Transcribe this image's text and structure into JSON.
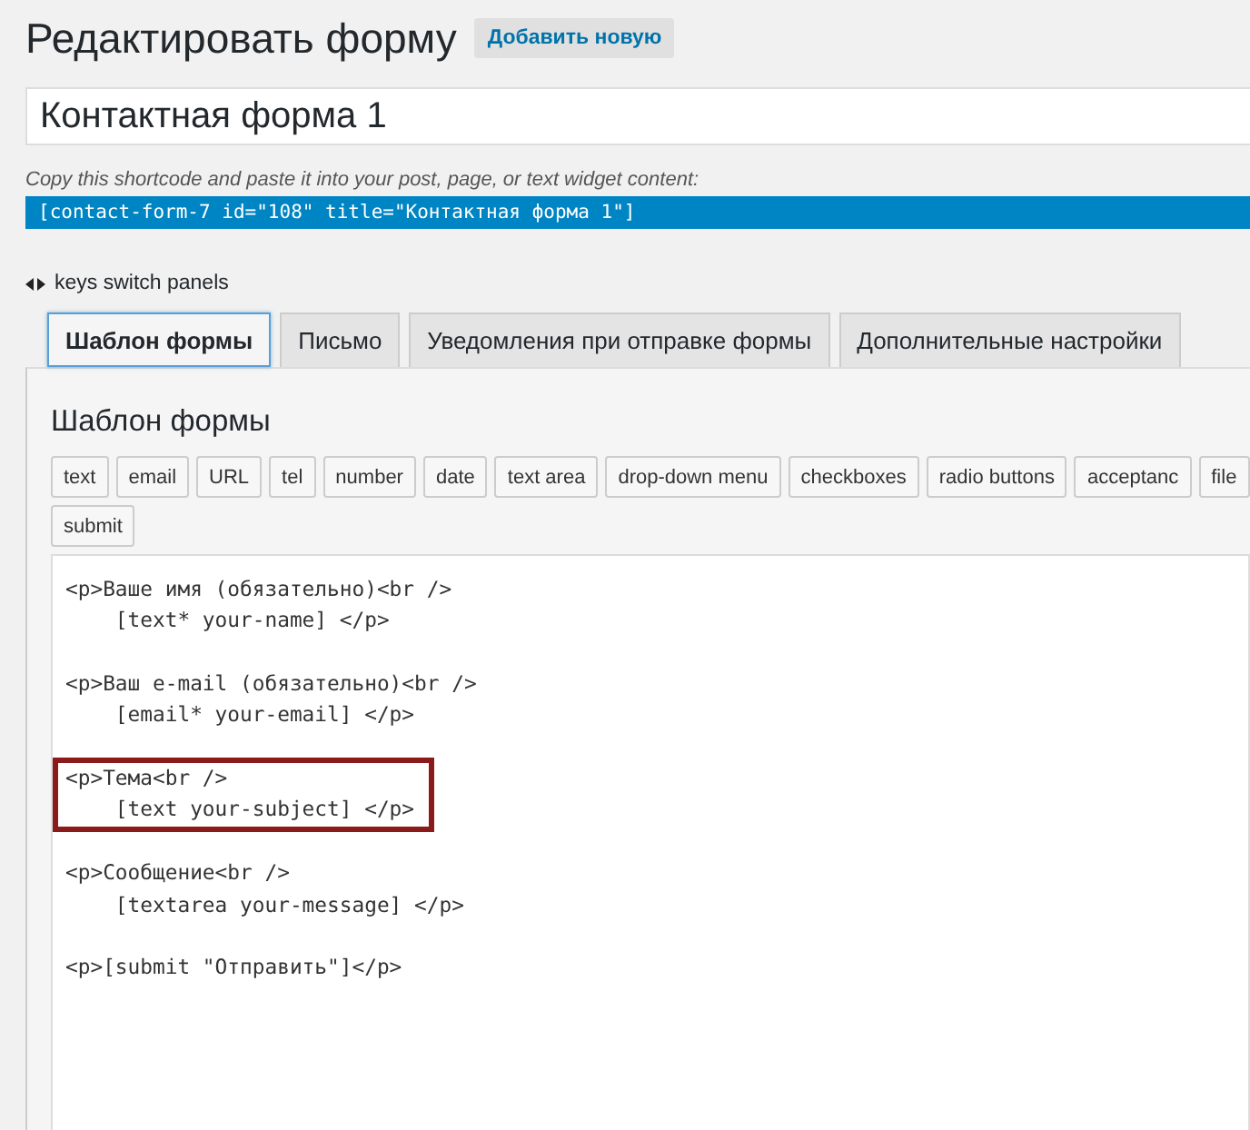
{
  "page_title": "Редактировать форму",
  "add_new_button": "Добавить новую",
  "form_title": {
    "value": "Контактная форма 1"
  },
  "shortcode_hint": "Copy this shortcode and paste it into your post, page, or text widget content:",
  "shortcode": "[contact-form-7 id=\"108\" title=\"Контактная форма 1\"]",
  "keys_hint": "keys switch panels",
  "tabs": [
    {
      "label": "Шаблон формы",
      "selected": true
    },
    {
      "label": "Письмо",
      "selected": false
    },
    {
      "label": "Уведомления при отправке формы",
      "selected": false
    },
    {
      "label": "Дополнительные настройки",
      "selected": false
    }
  ],
  "panel": {
    "heading": "Шаблон формы",
    "tag_buttons": [
      "text",
      "email",
      "URL",
      "tel",
      "number",
      "date",
      "text area",
      "drop-down menu",
      "checkboxes",
      "radio buttons",
      "acceptanc",
      "file",
      "submit"
    ],
    "editor_blocks": [
      {
        "highlighted": false,
        "lines": [
          "<p>Ваше имя (обязательно)<br />",
          "    [text* your-name] </p>"
        ]
      },
      {
        "highlighted": false,
        "lines": [
          "<p>Ваш e-mail (обязательно)<br />",
          "    [email* your-email] </p>"
        ]
      },
      {
        "highlighted": true,
        "lines": [
          "<p>Тема<br />",
          "    [text your-subject] </p>"
        ]
      },
      {
        "highlighted": false,
        "lines": [
          "<p>Сообщение<br />",
          "    [textarea your-message] </p>"
        ]
      },
      {
        "highlighted": false,
        "lines": [
          "<p>[submit \"Отправить\"]</p>"
        ]
      }
    ]
  }
}
